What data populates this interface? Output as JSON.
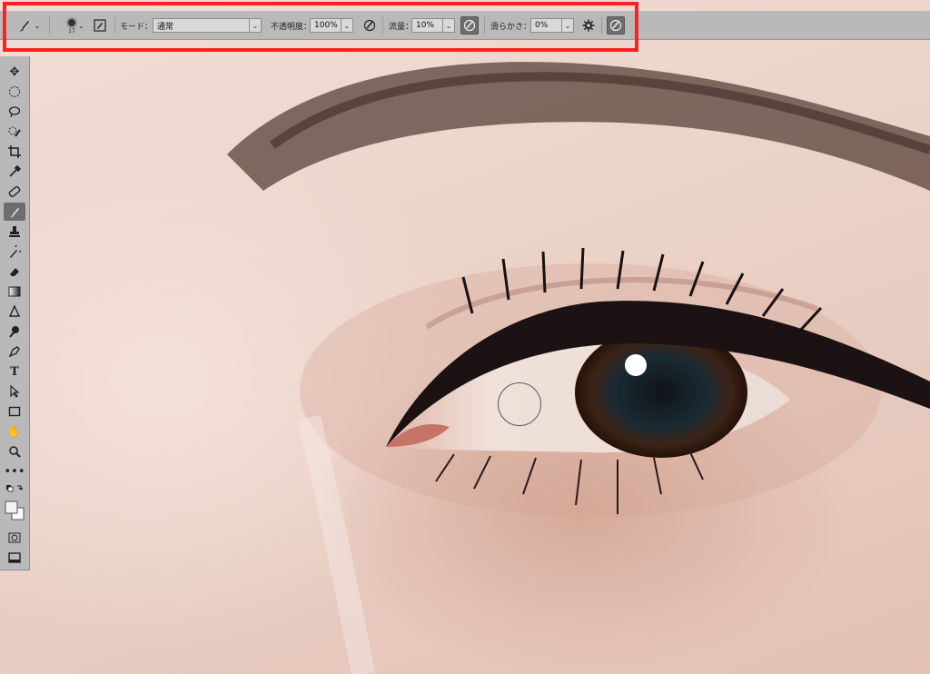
{
  "options_bar": {
    "mode_label": "モード：",
    "mode_value": "通常",
    "opacity_label": "不透明度：",
    "opacity_value": "100%",
    "flow_label": "流量：",
    "flow_value": "10%",
    "smoothing_label": "滑らかさ：",
    "smoothing_value": "0%",
    "brush_size": "17"
  },
  "colors": {
    "highlight": "#ff2020",
    "panel": "#b9b9b9",
    "active_tool": "#6d6d6d"
  },
  "toolbar": {
    "tools": [
      "move",
      "marquee",
      "lasso",
      "quick-select",
      "crop",
      "eyedropper",
      "healing",
      "brush",
      "stamp",
      "history-brush",
      "eraser",
      "gradient",
      "blur",
      "dodge",
      "pen",
      "type",
      "path-select",
      "rectangle",
      "hand",
      "zoom",
      "more",
      "swap-colors",
      "foreground-background",
      "quick-mask",
      "screen-mode"
    ],
    "active": "brush",
    "type_glyph": "T"
  }
}
